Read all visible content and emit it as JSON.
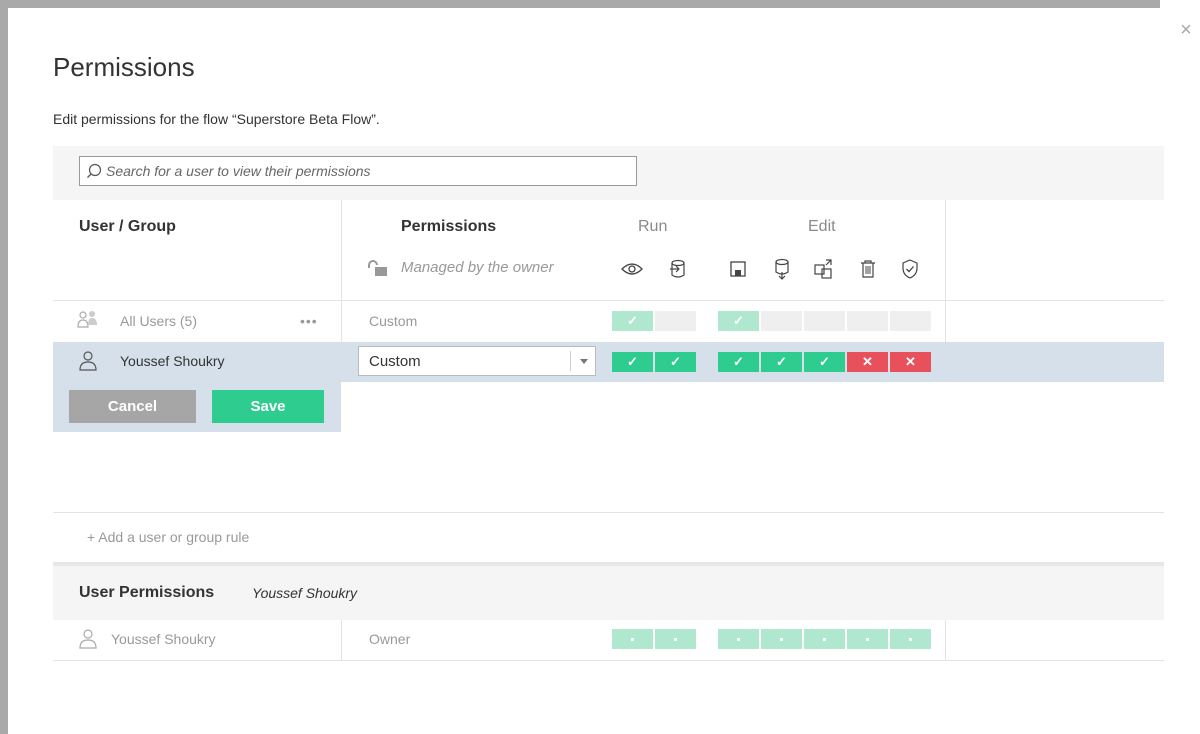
{
  "dialog": {
    "title": "Permissions",
    "subtitle": "Edit permissions for the flow “Superstore Beta Flow”.",
    "close_glyph": "×"
  },
  "search": {
    "placeholder": "Search for a user to view their permissions"
  },
  "headers": {
    "user_group": "User / Group",
    "permissions": "Permissions",
    "run": "Run",
    "edit": "Edit",
    "managed_by_owner": "Managed by the owner"
  },
  "capability_icons": {
    "run": [
      "eye-icon",
      "run-flow-icon"
    ],
    "edit": [
      "save-icon",
      "download-icon",
      "move-icon",
      "delete-icon",
      "set-permissions-icon"
    ]
  },
  "rows": [
    {
      "name": "All Users (5)",
      "icon": "group-icon",
      "more": "•••",
      "permission": "Custom",
      "run": [
        "allowed-light",
        "unspecified"
      ],
      "edit": [
        "allowed-light",
        "unspecified",
        "unspecified",
        "unspecified",
        "unspecified"
      ]
    },
    {
      "name": "Youssef Shoukry",
      "icon": "user-icon",
      "permission": "Custom",
      "selected": true,
      "run": [
        "allowed",
        "allowed"
      ],
      "edit": [
        "allowed",
        "allowed",
        "allowed",
        "denied",
        "denied"
      ]
    }
  ],
  "actions": {
    "cancel": "Cancel",
    "save": "Save"
  },
  "add_rule": "+ Add a user or group rule",
  "user_permissions": {
    "title": "User Permissions",
    "user": "Youssef Shoukry",
    "row": {
      "name": "Youssef Shoukry",
      "role": "Owner",
      "run": [
        "effective",
        "effective"
      ],
      "edit": [
        "effective",
        "effective",
        "effective",
        "effective",
        "effective"
      ]
    }
  },
  "glyphs": {
    "check": "✓",
    "cross": "✕"
  },
  "colors": {
    "allowed": "#2ecc8f",
    "allowed_light": "#b0e7cf",
    "denied": "#e8505b",
    "unspecified": "#efefef",
    "selected_row": "#d5e0ea"
  }
}
